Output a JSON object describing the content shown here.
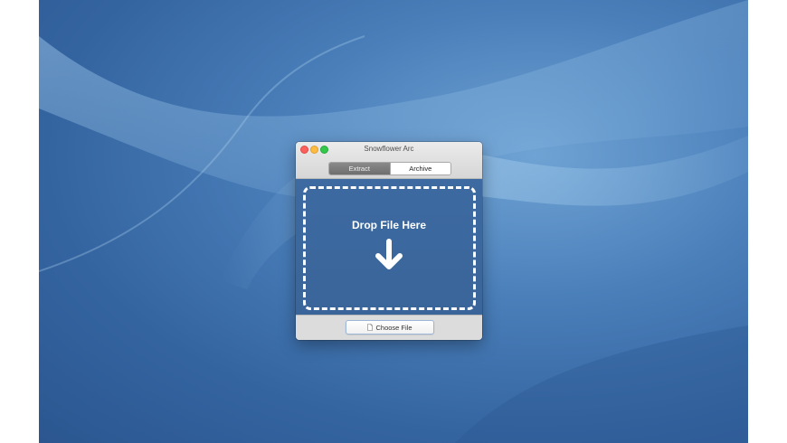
{
  "window": {
    "title": "Snowflower Arc",
    "tabs": [
      {
        "label": "Extract",
        "selected": false
      },
      {
        "label": "Archive",
        "selected": true
      }
    ],
    "dropzone": {
      "label": "Drop File Here",
      "icon": "arrow-down-icon"
    },
    "choose_button": {
      "label": "Choose File",
      "icon": "document-icon"
    }
  },
  "colors": {
    "accent": "#3c6aa1",
    "close": "#fc605c",
    "minimize": "#fdbc40",
    "maximize": "#34c84a"
  }
}
